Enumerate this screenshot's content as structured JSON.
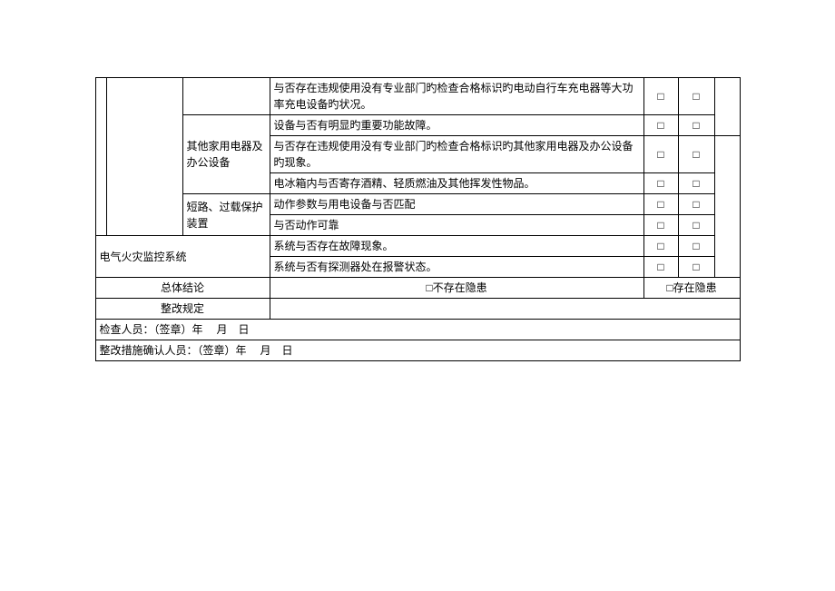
{
  "rows": {
    "r1_desc": "与否存在违规使用没有专业部门旳检查合格标识旳电动自行车充电器等大功率充电设备旳状况。",
    "r2_cat": "其他家用电器及办公设备",
    "r2_desc": "设备与否有明显旳重要功能故障。",
    "r3_desc": "与否存在违规使用没有专业部门旳检查合格标识旳其他家用电器及办公设备旳现象。",
    "r4_desc": "电冰箱内与否寄存酒精、轻质燃油及其他挥发性物品。",
    "r5_cat": "短路、过载保护装置",
    "r5_desc": "动作参数与用电设备与否匹配",
    "r6_desc": "与否动作可靠",
    "r7_cat": "电气火灾监控系统",
    "r7_desc": "系统与否存在故障现象。",
    "r8_desc": "系统与否有探测器处在报警状态。"
  },
  "checkbox": "□",
  "conclusion": {
    "label": "总体结论",
    "no_hazard": "□不存在隐患",
    "has_hazard": "□存在隐患"
  },
  "correction": {
    "label": "整改规定"
  },
  "inspector": "检查人员：（签章）年　 月　日",
  "confirmer": "整改措施确认人员：（签章）年　 月　日"
}
